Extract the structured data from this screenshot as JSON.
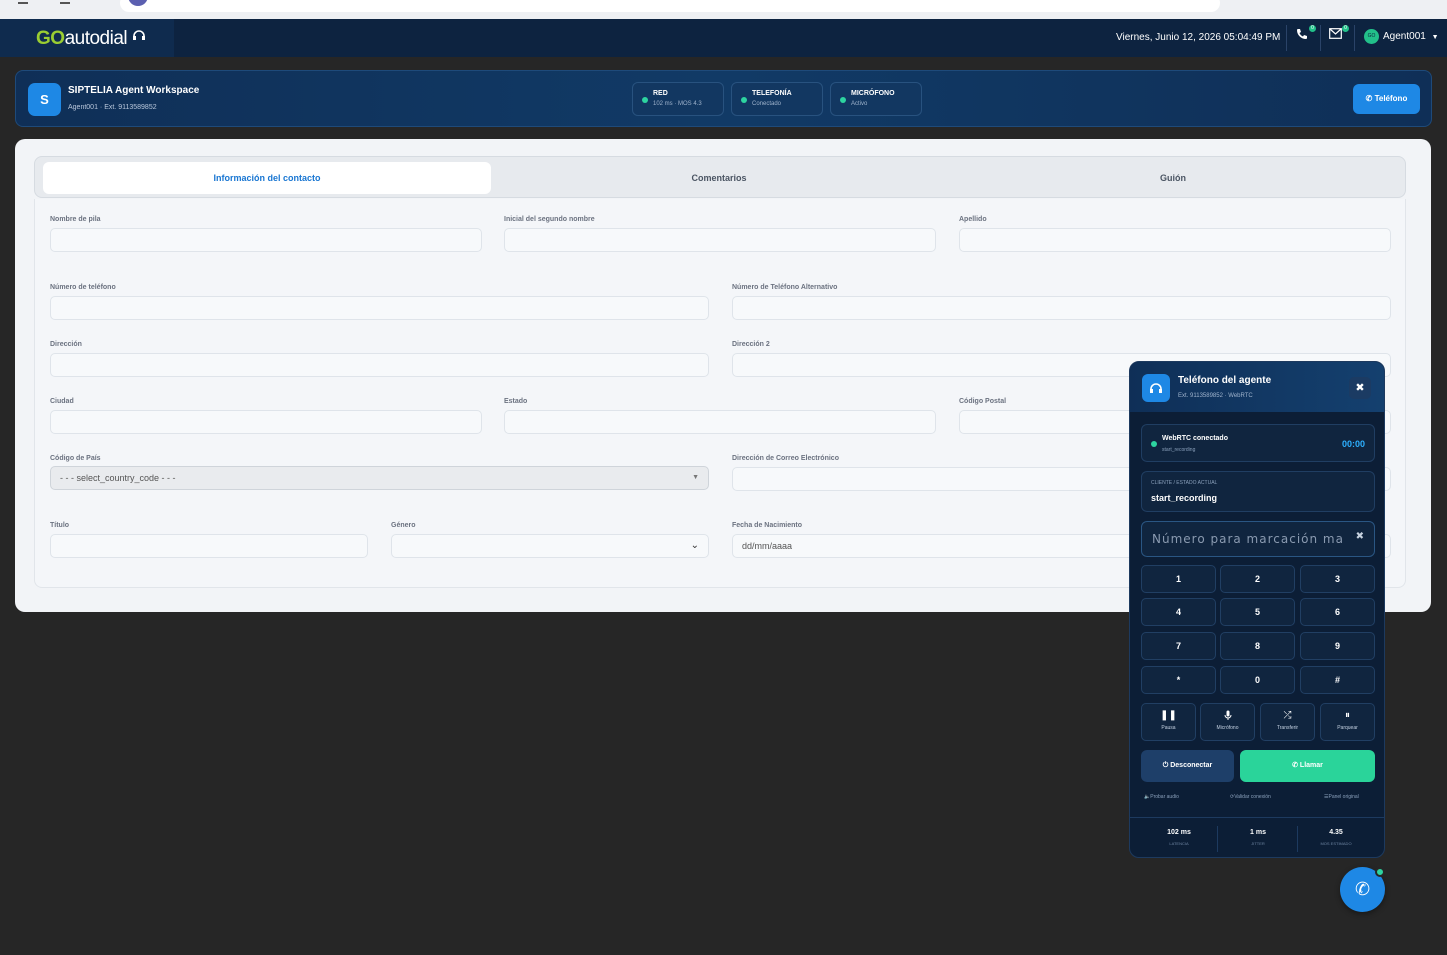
{
  "topbar": {
    "logo_go": "GO",
    "logo_rest": "autodial",
    "datetime": "Viernes, Junio 12, 2026 05:04:49 PM",
    "phone_badge": "0",
    "mail_badge": "0",
    "agent_initials": "GO",
    "agent_name": "Agent001"
  },
  "workspace": {
    "avatar": "S",
    "title": "SIPTELIA Agent Workspace",
    "subtitle": "Agent001 · Ext. 9113589852",
    "status": [
      {
        "title": "RED",
        "value": "102 ms · MOS 4.3"
      },
      {
        "title": "TELEFONÍA",
        "value": "Conectado"
      },
      {
        "title": "MICRÓFONO",
        "value": "Activo"
      }
    ],
    "phone_button": "Teléfono"
  },
  "tabs": [
    {
      "label": "Información del contacto",
      "active": true
    },
    {
      "label": "Comentarios",
      "active": false
    },
    {
      "label": "Guión",
      "active": false
    }
  ],
  "form": {
    "first_name": "Nombre de pila",
    "middle_initial": "Inicial del segundo nombre",
    "last_name": "Apellido",
    "phone": "Número de teléfono",
    "alt_phone": "Número de Teléfono Alternativo",
    "address": "Dirección",
    "address2": "Dirección 2",
    "city": "Ciudad",
    "state": "Estado",
    "postal": "Código Postal",
    "country": "Código de País",
    "country_value": "- - - select_country_code - - -",
    "email": "Dirección de Correo Electrónico",
    "title": "Título",
    "gender": "Género",
    "dob": "Fecha de Nacimiento",
    "dob_placeholder": "dd/mm/aaaa"
  },
  "widget": {
    "title": "Teléfono del agente",
    "subtitle": "Ext. 9113589852 · WebRTC",
    "conn_title": "WebRTC conectado",
    "conn_sub": "start_recording",
    "timer": "00:00",
    "client_label": "CLIENTE / ESTADO ACTUAL",
    "client_value": "start_recording",
    "dial_placeholder": "Número para marcación ma",
    "keys": [
      "1",
      "2",
      "3",
      "4",
      "5",
      "6",
      "7",
      "8",
      "9",
      "*",
      "0",
      "#"
    ],
    "actions": [
      {
        "icon": "pause-icon",
        "label": "Pausa"
      },
      {
        "icon": "microphone-icon",
        "label": "Micrófono"
      },
      {
        "icon": "transfer-icon",
        "label": "Transferir"
      },
      {
        "icon": "park-icon",
        "label": "Parquear"
      }
    ],
    "disconnect": "Desconectar",
    "call": "Llamar",
    "links": [
      "Probar audio",
      "Validar conexión",
      "Panel original"
    ],
    "stats": [
      {
        "value": "102 ms",
        "label": "LATENCIA"
      },
      {
        "value": "1 ms",
        "label": "JITTER"
      },
      {
        "value": "4.35",
        "label": "MOS ESTIMADO"
      }
    ]
  },
  "colors": {
    "navbar": "#0d2340",
    "accent": "#1e88e5",
    "success": "#2ad49a",
    "page_bg": "#262626"
  }
}
